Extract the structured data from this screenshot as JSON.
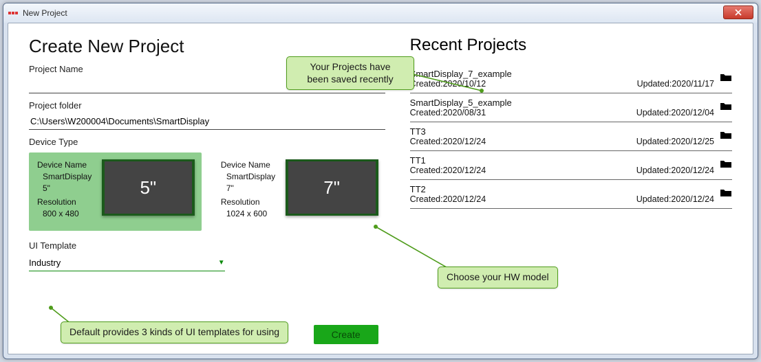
{
  "window": {
    "title": "New Project"
  },
  "left": {
    "heading": "Create New Project",
    "projectNameLabel": "Project Name",
    "projectNameValue": "",
    "projectFolderLabel": "Project folder",
    "projectFolderValue": "C:\\Users\\W200004\\Documents\\SmartDisplay",
    "deviceTypeLabel": "Device Type",
    "devices": [
      {
        "nameLabel": "Device Name",
        "name": "SmartDisplay 5\"",
        "resLabel": "Resolution",
        "res": "800 x 480",
        "screen": "5\"",
        "selected": true
      },
      {
        "nameLabel": "Device Name",
        "name": "SmartDisplay 7\"",
        "resLabel": "Resolution",
        "res": "1024 x 600",
        "screen": "7\"",
        "selected": false
      }
    ],
    "uiTemplateLabel": "UI Template",
    "uiTemplateValue": "Industry",
    "createLabel": "Create"
  },
  "right": {
    "heading": "Recent Projects",
    "items": [
      {
        "name": "SmartDisplay_7_example",
        "created": "Created:2020/10/12",
        "updated": "Updated:2020/11/17"
      },
      {
        "name": "SmartDisplay_5_example",
        "created": "Created:2020/08/31",
        "updated": "Updated:2020/12/04"
      },
      {
        "name": "TT3",
        "created": "Created:2020/12/24",
        "updated": "Updated:2020/12/25"
      },
      {
        "name": "TT1",
        "created": "Created:2020/12/24",
        "updated": "Updated:2020/12/24"
      },
      {
        "name": "TT2",
        "created": "Created:2020/12/24",
        "updated": "Updated:2020/12/24"
      }
    ]
  },
  "callouts": {
    "recent": "Your Projects have\nbeen saved recently",
    "hw": "Choose your HW model",
    "tmpl": "Default provides 3 kinds of UI templates for using"
  }
}
